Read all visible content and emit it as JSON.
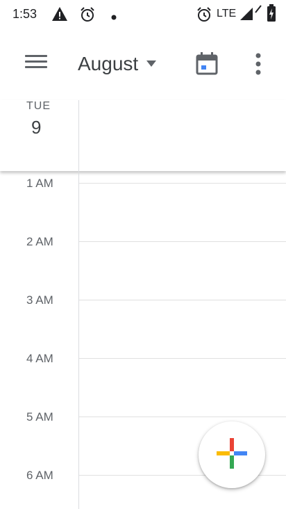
{
  "status_bar": {
    "time": "1:53",
    "network_label": "LTE",
    "icons": [
      "warning-icon",
      "alarm-icon",
      "notification-dot-icon",
      "alarm-icon",
      "wifi-icon",
      "signal-icon",
      "battery-icon"
    ]
  },
  "app_bar": {
    "menu_icon": "hamburger-menu-icon",
    "month_label": "August",
    "today_icon": "calendar-today-icon",
    "more_icon": "more-vert-icon"
  },
  "day_header": {
    "day_of_week": "TUE",
    "day_number": "9"
  },
  "hours": [
    "1 AM",
    "2 AM",
    "3 AM",
    "4 AM",
    "5 AM",
    "6 AM"
  ],
  "fab": {
    "icon": "plus-icon"
  },
  "colors": {
    "blue": "#4285f4",
    "red": "#ea4335",
    "yellow": "#fbbc04",
    "green": "#34a853",
    "grid": "#e0e0e0"
  }
}
